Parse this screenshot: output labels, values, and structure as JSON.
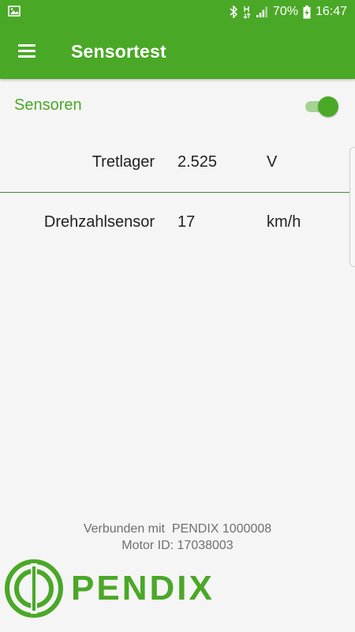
{
  "status_bar": {
    "time": "16:47",
    "battery": "70%",
    "icons": [
      "gallery-icon",
      "bluetooth-icon",
      "network-h-icon",
      "signal-icon",
      "battery-charging-icon"
    ]
  },
  "app_bar": {
    "title": "Sensortest",
    "menu_icon": "hamburger-menu-icon"
  },
  "section": {
    "title": "Sensoren",
    "toggle_state": "on"
  },
  "sensors": [
    {
      "name": "Tretlager",
      "value": "2.525",
      "unit": "V"
    },
    {
      "name": "Drehzahlsensor",
      "value": "17",
      "unit": "km/h"
    }
  ],
  "footer": {
    "connected_line": "Verbunden mit  PENDIX 1000008",
    "motor_line": "Motor ID: 17038003",
    "logo_text": "PENDIX"
  },
  "colors": {
    "brand_green": "#4aa827",
    "toggle_track": "#a5d392",
    "background": "#f5f5f5",
    "footer_text": "#6f6f6f"
  }
}
